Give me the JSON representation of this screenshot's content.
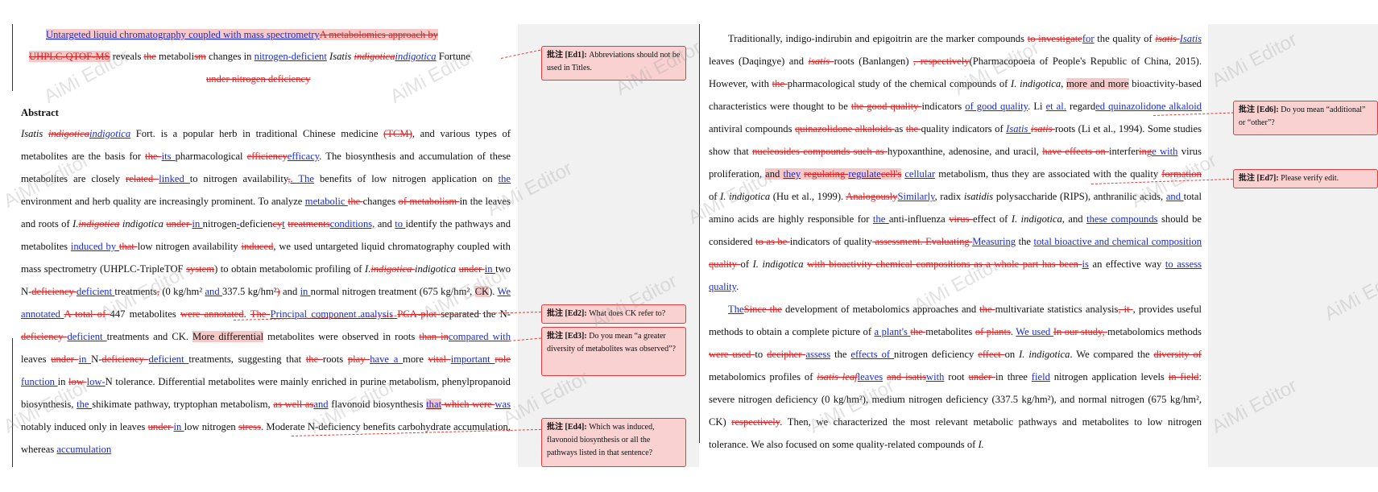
{
  "watermark": "AiMi Editor",
  "left": {
    "title": {
      "l1_ins": "Untargeted liquid chromatography coupled with mass spectrometry",
      "l1_del": "A metabolomics approach by",
      "l2_del1": "UHPLC-QTOF-MS",
      "l2_a": " reveals ",
      "l2_del2": "the",
      "l2_b": " metaboli",
      "l2_del3": "sm",
      "l2_c": " changes in ",
      "l2_ins1": "nitrogen-deficient",
      "l2_ital": " Isatis ",
      "l2_del4": "indigotica",
      "l2_ins2": "indigotica",
      "l2_d": " Fortune",
      "l3_del": "under nitrogen deficiency"
    },
    "abstract_heading": "Abstract",
    "abstract_end": "accumulation"
  },
  "comments": [
    {
      "tag": "批注 [Ed1]:",
      "text": " Abbreviations should not be used in Titles."
    },
    {
      "tag": "批注 [Ed2]:",
      "text": " What does CK refer to?"
    },
    {
      "tag": "批注 [Ed3]:",
      "text": " Do you mean “a greater diversity of metabolites was observed”?"
    },
    {
      "tag": "批注 [Ed4]:",
      "text": " Which was induced, flavonoid biosynthesis or all the pathways listed in that sentence?"
    },
    {
      "tag": "批注 [Ed6]:",
      "text": " Do you mean “additional” or “other”?"
    },
    {
      "tag": "批注 [Ed7]:",
      "text": " Please verify edit."
    }
  ]
}
